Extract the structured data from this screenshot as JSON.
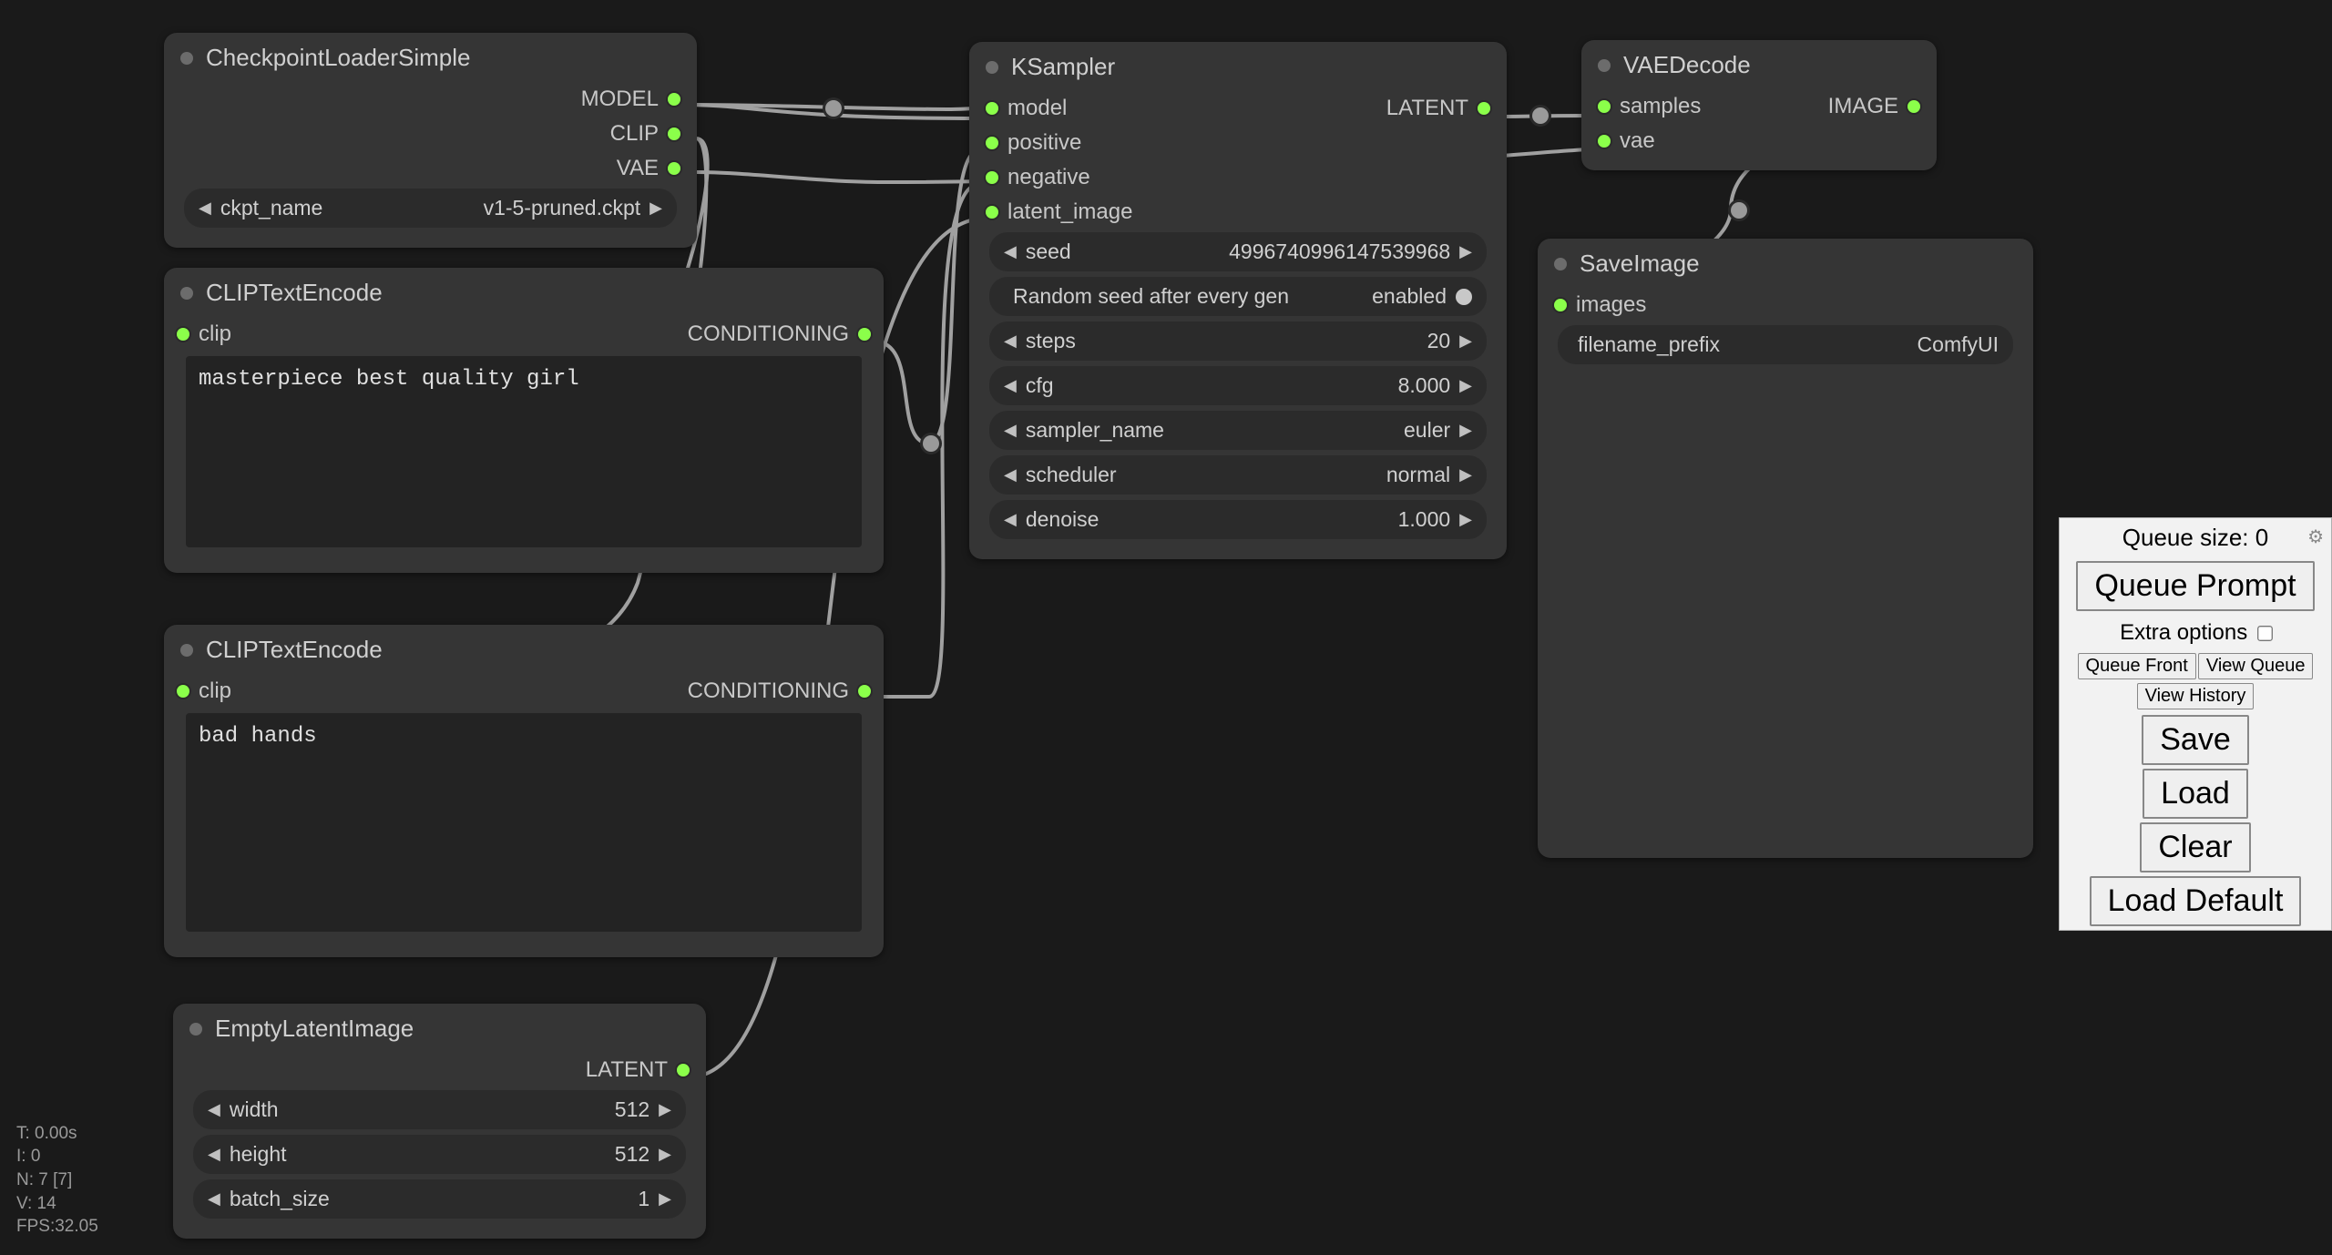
{
  "nodes": {
    "checkpoint": {
      "title": "CheckpointLoaderSimple",
      "outputs": {
        "model": "MODEL",
        "clip": "CLIP",
        "vae": "VAE"
      },
      "widget": {
        "label": "ckpt_name",
        "value": "v1-5-pruned.ckpt"
      }
    },
    "clip_pos": {
      "title": "CLIPTextEncode",
      "inputs": {
        "clip": "clip"
      },
      "outputs": {
        "cond": "CONDITIONING"
      },
      "text": "masterpiece best quality girl"
    },
    "clip_neg": {
      "title": "CLIPTextEncode",
      "inputs": {
        "clip": "clip"
      },
      "outputs": {
        "cond": "CONDITIONING"
      },
      "text": "bad hands"
    },
    "empty_latent": {
      "title": "EmptyLatentImage",
      "outputs": {
        "latent": "LATENT"
      },
      "widgets": {
        "width": {
          "label": "width",
          "value": "512"
        },
        "height": {
          "label": "height",
          "value": "512"
        },
        "batch": {
          "label": "batch_size",
          "value": "1"
        }
      }
    },
    "ksampler": {
      "title": "KSampler",
      "inputs": {
        "model": "model",
        "positive": "positive",
        "negative": "negative",
        "latent_image": "latent_image"
      },
      "outputs": {
        "latent": "LATENT"
      },
      "widgets": {
        "seed": {
          "label": "seed",
          "value": "4996740996147539968"
        },
        "random": {
          "label": "Random seed after every gen",
          "value": "enabled"
        },
        "steps": {
          "label": "steps",
          "value": "20"
        },
        "cfg": {
          "label": "cfg",
          "value": "8.000"
        },
        "sampler": {
          "label": "sampler_name",
          "value": "euler"
        },
        "scheduler": {
          "label": "scheduler",
          "value": "normal"
        },
        "denoise": {
          "label": "denoise",
          "value": "1.000"
        }
      }
    },
    "vae_decode": {
      "title": "VAEDecode",
      "inputs": {
        "samples": "samples",
        "vae": "vae"
      },
      "outputs": {
        "image": "IMAGE"
      }
    },
    "save_image": {
      "title": "SaveImage",
      "inputs": {
        "images": "images"
      },
      "widget": {
        "label": "filename_prefix",
        "value": "ComfyUI"
      }
    }
  },
  "panel": {
    "queue_size_label": "Queue size: 0",
    "queue_prompt": "Queue Prompt",
    "extra_options": "Extra options",
    "queue_front": "Queue Front",
    "view_queue": "View Queue",
    "view_history": "View History",
    "save": "Save",
    "load": "Load",
    "clear": "Clear",
    "load_default": "Load Default"
  },
  "status": {
    "t": "T: 0.00s",
    "i": "I: 0",
    "n": "N: 7 [7]",
    "v": "V: 14",
    "fps": "FPS:32.05"
  }
}
